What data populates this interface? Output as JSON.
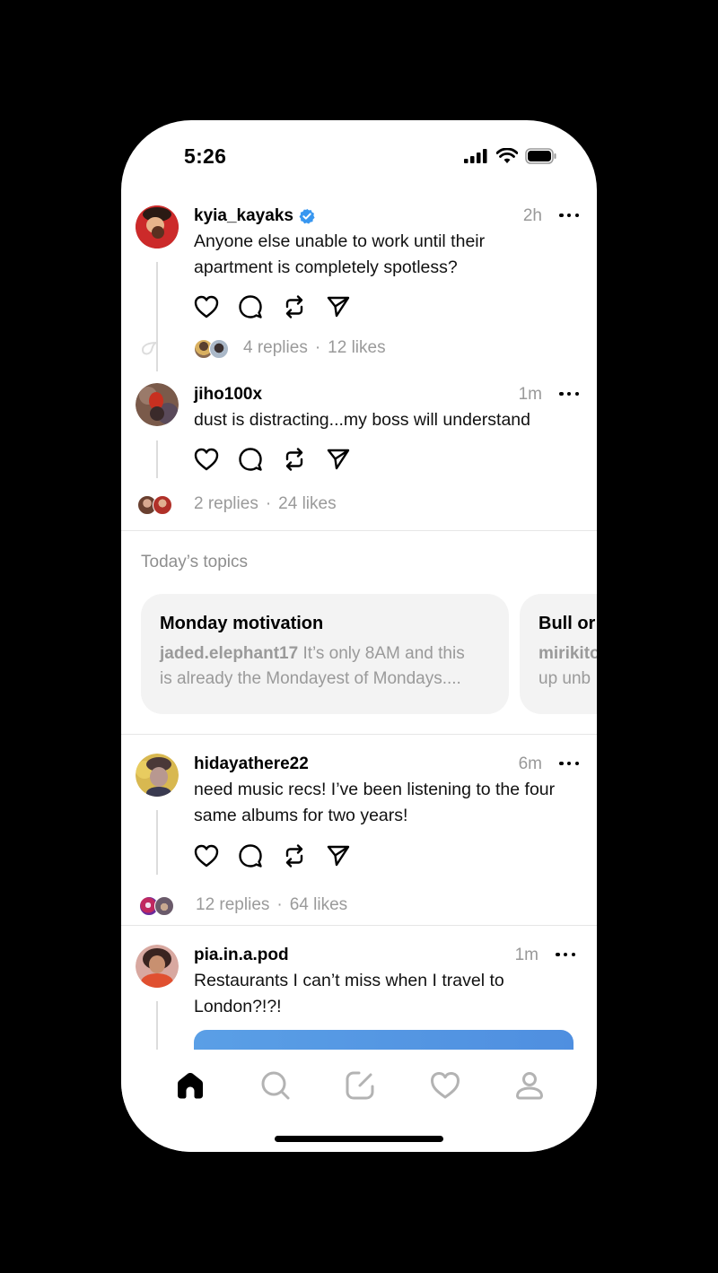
{
  "status_bar": {
    "time": "5:26",
    "icons": [
      "cellular-signal-icon",
      "wifi-icon",
      "battery-icon"
    ]
  },
  "colors": {
    "verified": "#3897f0",
    "muted_text": "#999999",
    "topic_card_bg": "#f3f3f3",
    "tab_active": "#000000",
    "tab_inactive": "#b3b3b3",
    "media_preview": "#5a9fe6"
  },
  "posts": [
    {
      "username": "kyia_kayaks",
      "verified": true,
      "time": "2h",
      "text": "Anyone else unable to work until their apartment is completely spotless?",
      "replies": "4 replies",
      "likes": "12 likes",
      "separator": "·"
    },
    {
      "username": "jiho100x",
      "verified": false,
      "time": "1m",
      "text": "dust is distracting...my boss will understand",
      "replies": "2 replies",
      "likes": "24 likes",
      "separator": "·"
    },
    {
      "username": "hidayathere22",
      "verified": false,
      "time": "6m",
      "text": "need music recs! I’ve been listening to the four same albums for two years!",
      "replies": "12 replies",
      "likes": "64 likes",
      "separator": "·"
    },
    {
      "username": "pia.in.a.pod",
      "verified": false,
      "time": "1m",
      "text": "Restaurants I can’t miss when I travel to London?!?!"
    }
  ],
  "topics": {
    "title": "Today’s topics",
    "cards": [
      {
        "title": "Monday motivation",
        "author": "jaded.elephant17",
        "snippet_line1": " It’s only 8AM and this",
        "snippet_line2": "is already the Mondayest of Mondays...."
      },
      {
        "title": "Bull or",
        "author": "mirikito",
        "snippet_line1": "",
        "snippet_line2": "up unb"
      }
    ]
  },
  "tab_bar": {
    "items": [
      {
        "name": "home",
        "icon": "home-icon",
        "active": true
      },
      {
        "name": "search",
        "icon": "search-icon",
        "active": false
      },
      {
        "name": "compose",
        "icon": "compose-icon",
        "active": false
      },
      {
        "name": "activity",
        "icon": "heart-icon",
        "active": false
      },
      {
        "name": "profile",
        "icon": "profile-icon",
        "active": false
      }
    ]
  }
}
